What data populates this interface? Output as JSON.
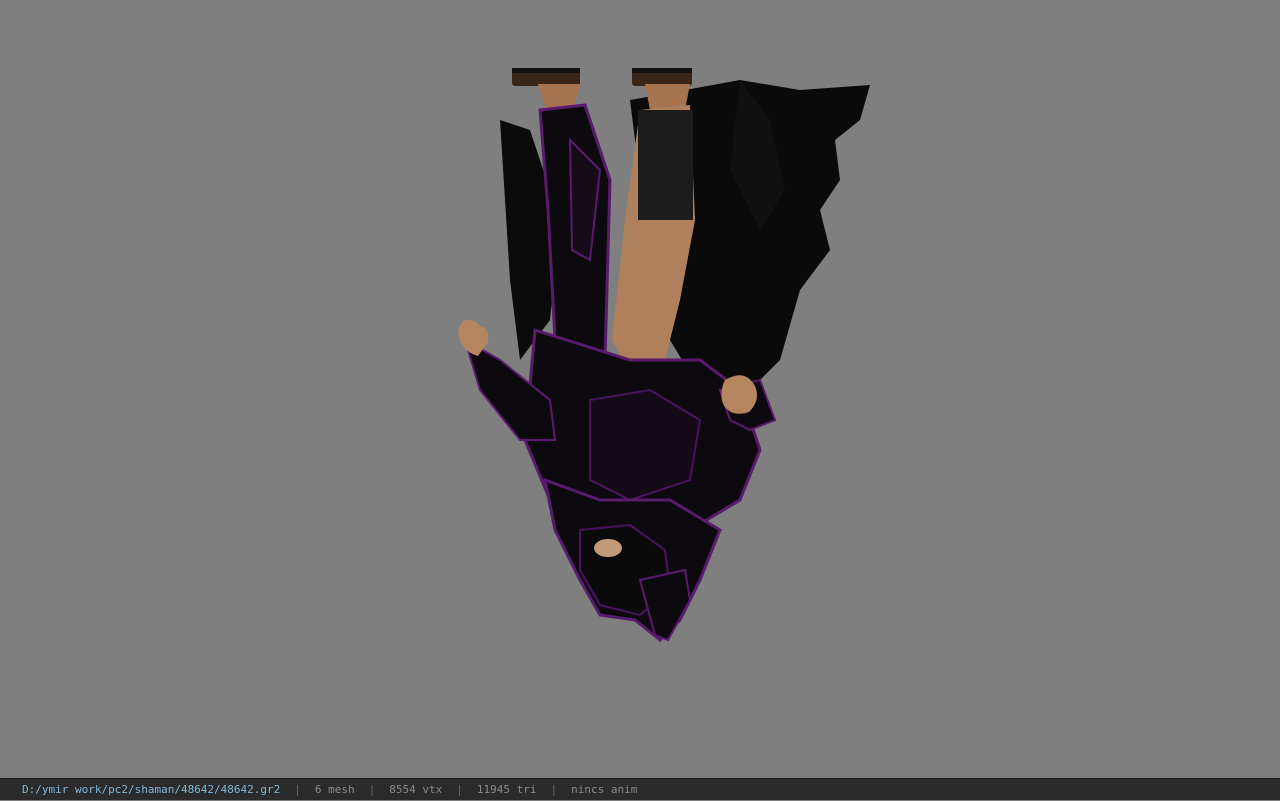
{
  "viewport": {
    "background": "#7f7f7f",
    "model_description_icon": "upside-down-character-model"
  },
  "statusbar": {
    "file_path": "D:/ymir work/pc2/shaman/48642/48642.gr2",
    "separator": "|",
    "mesh_count": "6 mesh",
    "vertex_count": "8554 vtx",
    "triangle_count": "11945 tri",
    "anim_status": "nincs anim"
  },
  "colors": {
    "armor": "#0d0a0f",
    "armor_trim": "#5a1a6e",
    "skin": "#b88560",
    "status_bg": "#2b2b2b",
    "path_text": "#7fb8d8",
    "status_text": "#8a8a8a"
  }
}
